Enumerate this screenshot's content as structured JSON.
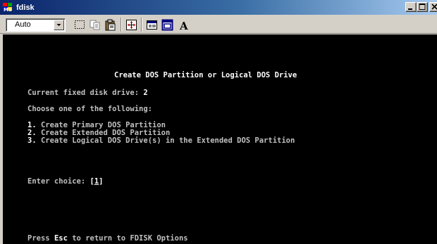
{
  "window": {
    "title": "fdisk"
  },
  "toolbar": {
    "font_size_value": "Auto",
    "buttons": [
      {
        "name": "mark-icon"
      },
      {
        "name": "copy-icon"
      },
      {
        "name": "paste-icon"
      },
      {
        "name": "fullscreen-icon"
      },
      {
        "name": "properties-icon"
      },
      {
        "name": "background-icon"
      },
      {
        "name": "font-icon",
        "label": "A"
      }
    ]
  },
  "console": {
    "heading": "Create DOS Partition or Logical DOS Drive",
    "current_drive_label": "Current fixed disk drive: ",
    "current_drive_value": "2",
    "prompt": "Choose one of the following:",
    "options": [
      {
        "number": "1.",
        "text": " Create Primary DOS Partition"
      },
      {
        "number": "2.",
        "text": " Create Extended DOS Partition"
      },
      {
        "number": "3.",
        "text": " Create Logical DOS Drive(s) in the Extended DOS Partition"
      }
    ],
    "enter_choice_label": "Enter choice: ",
    "enter_choice_open": "[",
    "enter_choice_value": "1",
    "enter_choice_close": "]",
    "footer_prefix": "Press ",
    "footer_key": "Esc",
    "footer_suffix": " to return to FDISK Options"
  },
  "colors": {
    "titlebar_start": "#0a246a",
    "titlebar_end": "#a6caf0",
    "console_bg": "#000000",
    "console_text": "#c0c0c0",
    "console_highlight": "#ffffff"
  }
}
